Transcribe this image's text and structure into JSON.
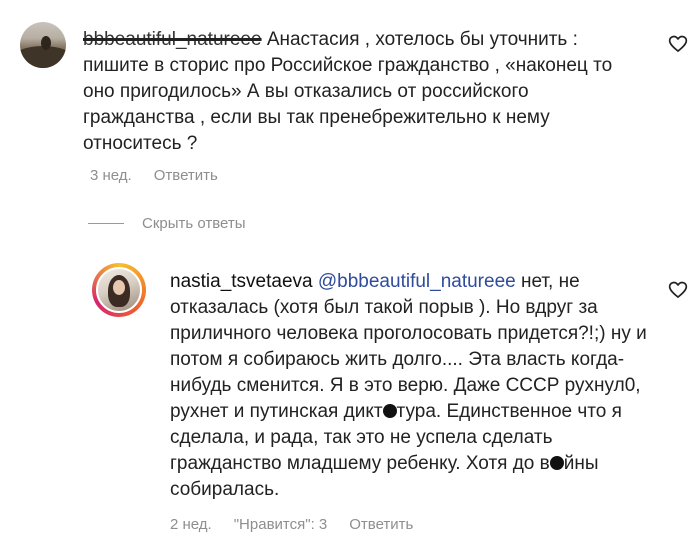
{
  "comment1": {
    "username": "bbbeautiful_natureee",
    "text": "Анастасия , хотелось бы уточнить : пишите в сторис про Российское гражданство , «наконец то оно пригодилось» А вы отказались от российского гражданства , если вы так пренебрежительно к нему относитесь ?",
    "time": "3 нед.",
    "reply_label": "Ответить"
  },
  "hide_replies_label": "Скрыть ответы",
  "comment2": {
    "username": "nastia_tsvetaeva",
    "mention": "@bbbeautiful_natureee",
    "text_part1": " нет, не отказалась (хотя был такой порыв ). Но вдруг за приличного человека проголосовать придется?!;) ну и потом я собираюсь жить долго.... Эта власть когда-нибудь сменится. Я в это верю. Даже СССР рухнул0, рухнет и путинская дикт",
    "text_part2": "тура. Единственное что я сделала, и рада, так это не успела сделать гражданство младшему ребенку. Хотя до в",
    "text_part3": "йны собиралась.",
    "time": "2 нед.",
    "likes": "\"Нравится\": 3",
    "reply_label": "Ответить"
  },
  "icons": {
    "like": "heart-outline-icon",
    "avatar1": "landscape-avatar",
    "avatar2": "profile-photo-avatar"
  }
}
